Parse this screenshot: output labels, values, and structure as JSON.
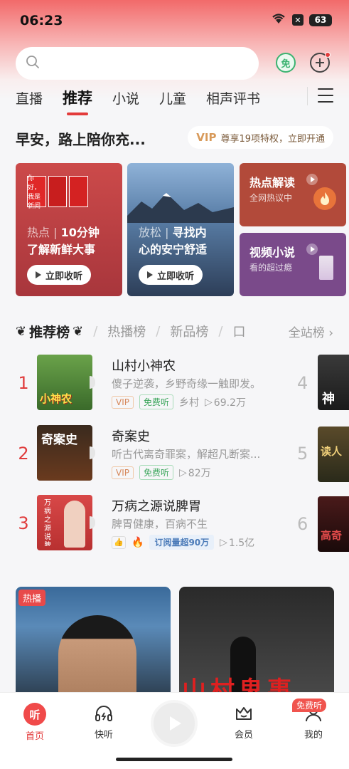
{
  "status": {
    "time": "06:23",
    "battery": "63"
  },
  "search": {
    "placeholder": ""
  },
  "header": {
    "free_label": "免"
  },
  "tabs": [
    {
      "label": "直播"
    },
    {
      "label": "推荐"
    },
    {
      "label": "小说"
    },
    {
      "label": "儿童"
    },
    {
      "label": "相声评书"
    }
  ],
  "greeting": "早安，路上陪你充...",
  "vip_banner": {
    "vip": "VIP",
    "text": "尊享19项特权，立即开通"
  },
  "cards": {
    "c1": {
      "cover_text": "你好，我是新闻",
      "muted": "热点",
      "line1": "10分钟",
      "line2": "了解新鲜大事",
      "button": "立即收听"
    },
    "c2": {
      "muted": "放松",
      "line1": "寻找内",
      "line2": "心的安宁舒适",
      "button": "立即收听"
    },
    "c3": {
      "title": "热点解读",
      "sub": "全网热议中"
    },
    "c4": {
      "title": "视频小说",
      "sub": "看的超过瘾"
    }
  },
  "rank_tabs": [
    {
      "label": "推荐榜"
    },
    {
      "label": "热播榜"
    },
    {
      "label": "新品榜"
    },
    {
      "label": "口"
    }
  ],
  "rank_all": "全站榜",
  "rank_items": [
    {
      "num": "1",
      "title": "山村小神农",
      "desc": "傻子逆袭，乡野奇缘一触即发。",
      "tags": [
        "VIP",
        "免费听"
      ],
      "category": "乡村",
      "plays": "69.2万",
      "cover_text": "小神农"
    },
    {
      "num": "2",
      "title": "奇案史",
      "desc": "听古代离奇罪案，解超凡断案...",
      "tags": [
        "VIP",
        "免费听"
      ],
      "category": "",
      "plays": "82万",
      "cover_text": "奇案史"
    },
    {
      "num": "3",
      "title": "万病之源说脾胃",
      "desc": "脾胃健康，百病不生",
      "tags": [
        "订阅量超90万"
      ],
      "category": "",
      "plays": "1.5亿",
      "cover_text": "万病之源说脾胃"
    }
  ],
  "side_items": [
    {
      "num": "4",
      "cover_text": "神"
    },
    {
      "num": "5",
      "cover_text": "读人"
    },
    {
      "num": "6",
      "cover_text": "高奇"
    }
  ],
  "feed": [
    {
      "badge": "热播"
    },
    {
      "badge": "",
      "cover_text": "山村鬼事"
    }
  ],
  "bottom_nav": [
    {
      "label": "首页",
      "icon_text": "听"
    },
    {
      "label": "快听"
    },
    {
      "label": "会员"
    },
    {
      "label": "我的",
      "badge": "免费听"
    }
  ]
}
